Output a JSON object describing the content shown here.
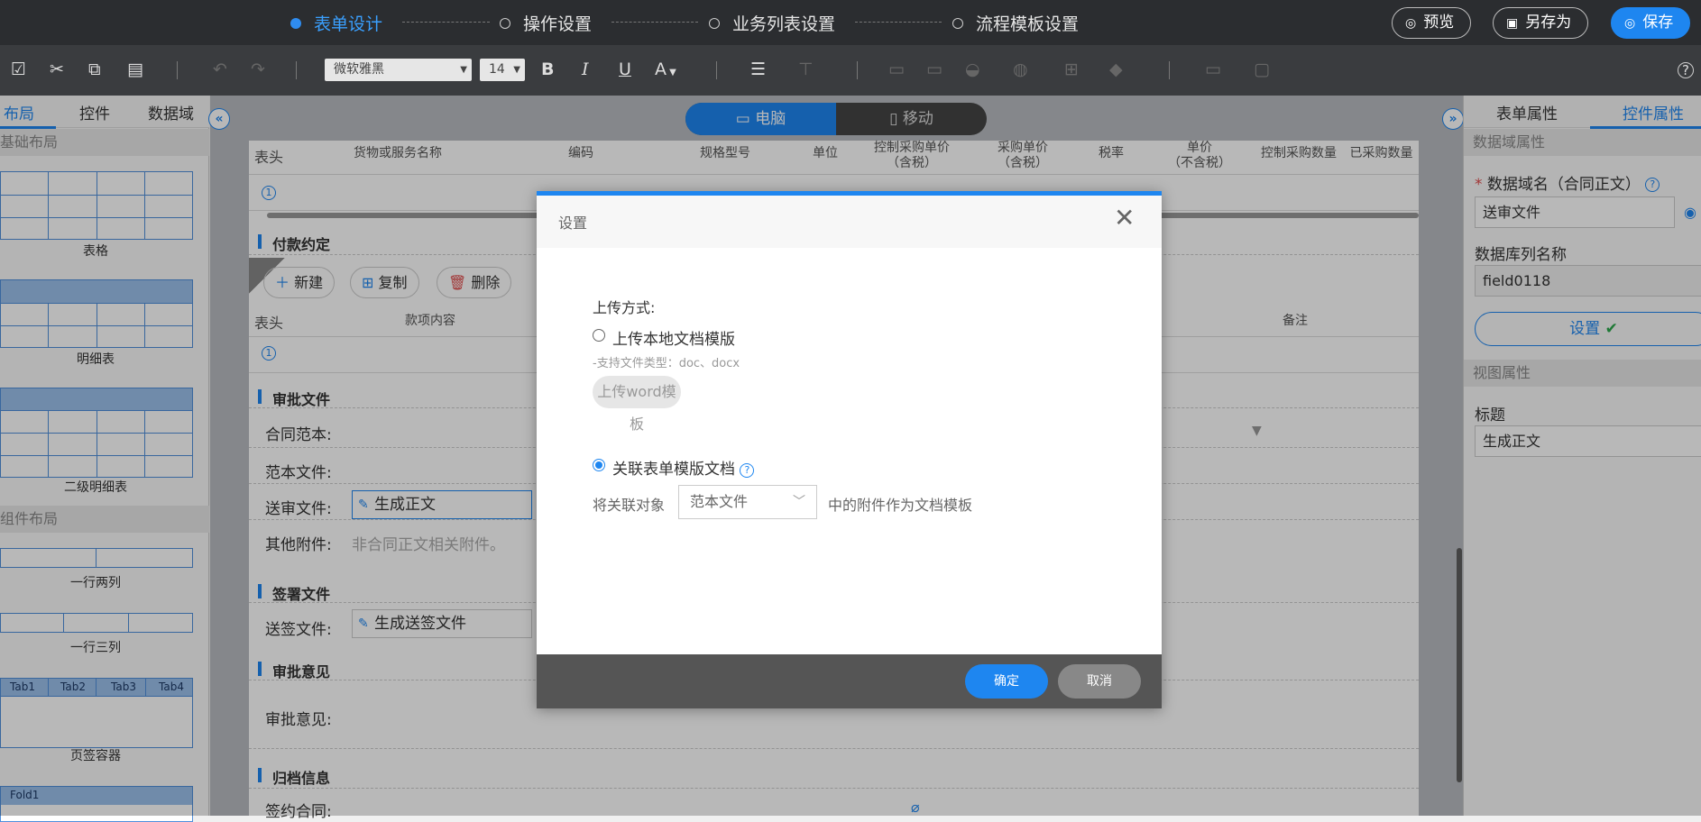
{
  "topbar": {
    "steps": [
      "表单设计",
      "操作设置",
      "业务列表设置",
      "流程模板设置"
    ],
    "preview": "预览",
    "save_as": "另存为",
    "save": "保存"
  },
  "toolbar": {
    "font_family": "微软雅黑",
    "font_size": "14",
    "bold": "B",
    "italic": "I",
    "underline": "U",
    "font_color": "A",
    "help": "?"
  },
  "left_panel": {
    "tabs": [
      "布局",
      "控件",
      "数据域"
    ],
    "sections": [
      "基础布局",
      "组件布局"
    ],
    "items": {
      "table": "表格",
      "detail_table": "明细表",
      "sub_detail_table": "二级明细表",
      "row_two": "一行两列",
      "row_three": "一行三列",
      "tab_container": "页签容器",
      "fold": "Fold1"
    },
    "tab_labels": [
      "Tab1",
      "Tab2",
      "Tab3",
      "Tab4"
    ]
  },
  "device_switch": {
    "pc": "电脑",
    "mobile": "移动"
  },
  "form": {
    "table1_headers": [
      "表头",
      "货物或服务名称",
      "编码",
      "规格型号",
      "单位",
      "控制采购单价\n（含税）",
      "采购单价\n（含税）",
      "税率",
      "单价\n（不含税）",
      "控制采购数量",
      "已采购数量"
    ],
    "row_index": "1",
    "payment_title": "付款约定",
    "btn_new": "新建",
    "btn_copy": "复制",
    "btn_delete": "删除",
    "table2_headers": [
      "表头",
      "款项内容",
      "备注"
    ],
    "approval_docs_title": "审批文件",
    "contract_template_label": "合同范本:",
    "template_file_label": "范本文件:",
    "review_file_label": "送审文件:",
    "review_file_value": "生成正文",
    "other_attachments_label": "其他附件:",
    "other_attachments_placeholder": "非合同正文相关附件。",
    "sign_docs_title": "签署文件",
    "sign_file_label": "送签文件:",
    "sign_file_value": "生成送签文件",
    "opinion_title": "审批意见",
    "opinion_label": "审批意见:",
    "archive_title": "归档信息",
    "signed_contract_label": "签约合同:"
  },
  "right_panel": {
    "tabs": [
      "表单属性",
      "控件属性"
    ],
    "data_attr_section": "数据域属性",
    "data_name_label": "数据域名（合同正文）",
    "data_name_value": "送审文件",
    "db_col_label": "数据库列名称",
    "db_col_value": "field0118",
    "settings_button": "设置",
    "view_attr_section": "视图属性",
    "title_label": "标题",
    "title_value": "生成正文"
  },
  "dialog": {
    "title": "设置",
    "upload_method_label": "上传方式:",
    "option_local": "上传本地文档模版",
    "support_hint": "-支持文件类型：doc、docx",
    "upload_button": "上传word模板",
    "option_linked": "关联表单模版文档",
    "link_prefix": "将关联对象",
    "link_select_value": "范本文件",
    "link_suffix": "中的附件作为文档模板",
    "confirm": "确定",
    "cancel": "取消",
    "selected_option": "linked"
  },
  "colors": {
    "accent": "#1e86f0",
    "topbar": "#2b2d30",
    "toolbar": "#3a3c3f"
  }
}
